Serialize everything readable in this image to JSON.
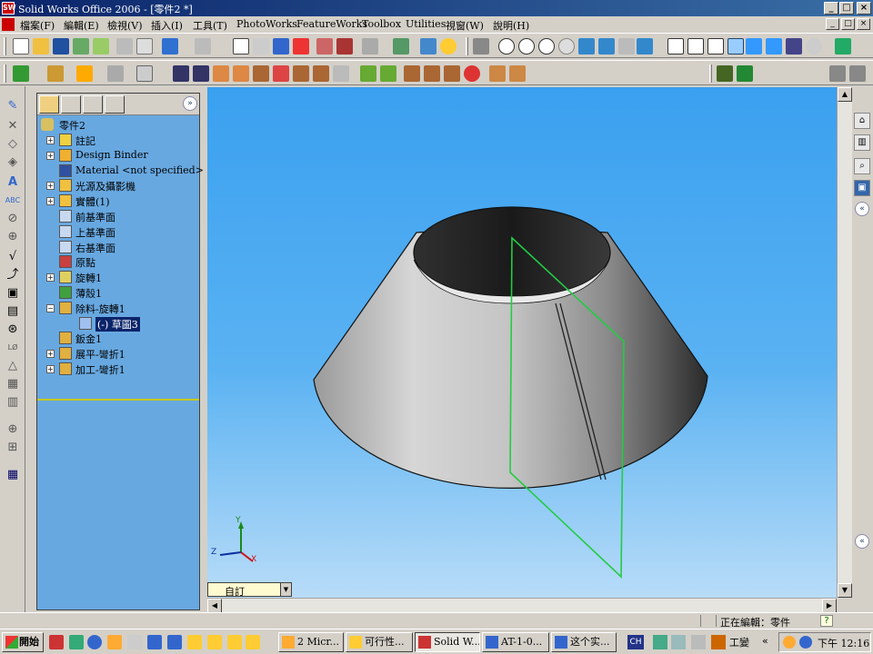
{
  "window": {
    "title": "Solid Works Office 2006 - [零件2 *]",
    "app_icon_text": "SW",
    "minimize": "_",
    "maximize": "□",
    "close": "×"
  },
  "menu": {
    "items": [
      "檔案(F)",
      "編輯(E)",
      "檢視(V)",
      "插入(I)",
      "工具(T)",
      "PhotoWorks",
      "FeatureWorks",
      "Toolbox",
      "Utilities",
      "視窗(W)",
      "說明(H)"
    ]
  },
  "tree": {
    "root": "零件2",
    "items": [
      {
        "label": "註記",
        "icon": "annotations-icon",
        "expandable": true,
        "indent": 0
      },
      {
        "label": "Design Binder",
        "icon": "design-binder-icon",
        "expandable": true,
        "indent": 0
      },
      {
        "label": "Material <not specified>",
        "icon": "material-icon",
        "expandable": false,
        "indent": 0
      },
      {
        "label": "光源及攝影機",
        "icon": "lights-cameras-icon",
        "expandable": true,
        "indent": 0
      },
      {
        "label": "實體(1)",
        "icon": "solid-bodies-icon",
        "expandable": true,
        "indent": 0
      },
      {
        "label": "前基準面",
        "icon": "plane-icon",
        "expandable": false,
        "indent": 0
      },
      {
        "label": "上基準面",
        "icon": "plane-icon",
        "expandable": false,
        "indent": 0
      },
      {
        "label": "右基準面",
        "icon": "plane-icon",
        "expandable": false,
        "indent": 0
      },
      {
        "label": "原點",
        "icon": "origin-icon",
        "expandable": false,
        "indent": 0
      },
      {
        "label": "旋轉1",
        "icon": "revolve-icon",
        "expandable": true,
        "indent": 0
      },
      {
        "label": "薄殼1",
        "icon": "shell-icon",
        "expandable": false,
        "indent": 0
      },
      {
        "label": "除料-旋轉1",
        "icon": "cut-revolve-icon",
        "expandable": true,
        "expanded": true,
        "indent": 0
      },
      {
        "label": "(-) 草圖3",
        "icon": "sketch-icon",
        "expandable": false,
        "indent": 1,
        "selected": true
      },
      {
        "label": "鈑金1",
        "icon": "sheet-metal-icon",
        "expandable": false,
        "indent": 0
      },
      {
        "label": "展平-彎折1",
        "icon": "flatten-bends-icon",
        "expandable": true,
        "indent": 0
      },
      {
        "label": "加工-彎折1",
        "icon": "process-bends-icon",
        "expandable": true,
        "indent": 0
      }
    ]
  },
  "viewport": {
    "triad": {
      "x": "X",
      "y": "Y",
      "z": "Z"
    }
  },
  "config": {
    "value": "自訂"
  },
  "status": {
    "editing": "正在編輯：零件",
    "help": "?"
  },
  "taskbar": {
    "start": "開始",
    "tasks": [
      {
        "label": "2 Micr...",
        "active": false
      },
      {
        "label": "可行性...",
        "active": false
      },
      {
        "label": "Solid W...",
        "active": true
      },
      {
        "label": "AT-1-0...",
        "active": false
      },
      {
        "label": "这个实...",
        "active": false
      }
    ],
    "ime": "CH",
    "ime_text": "工變",
    "clock": "下午 12:16"
  },
  "colors": {
    "title_start": "#0a246a",
    "title_end": "#3a6ea5",
    "tree_bg": "#68a8e0",
    "viewport_top": "#3aa0f0",
    "sketch_line": "#22cc44"
  }
}
